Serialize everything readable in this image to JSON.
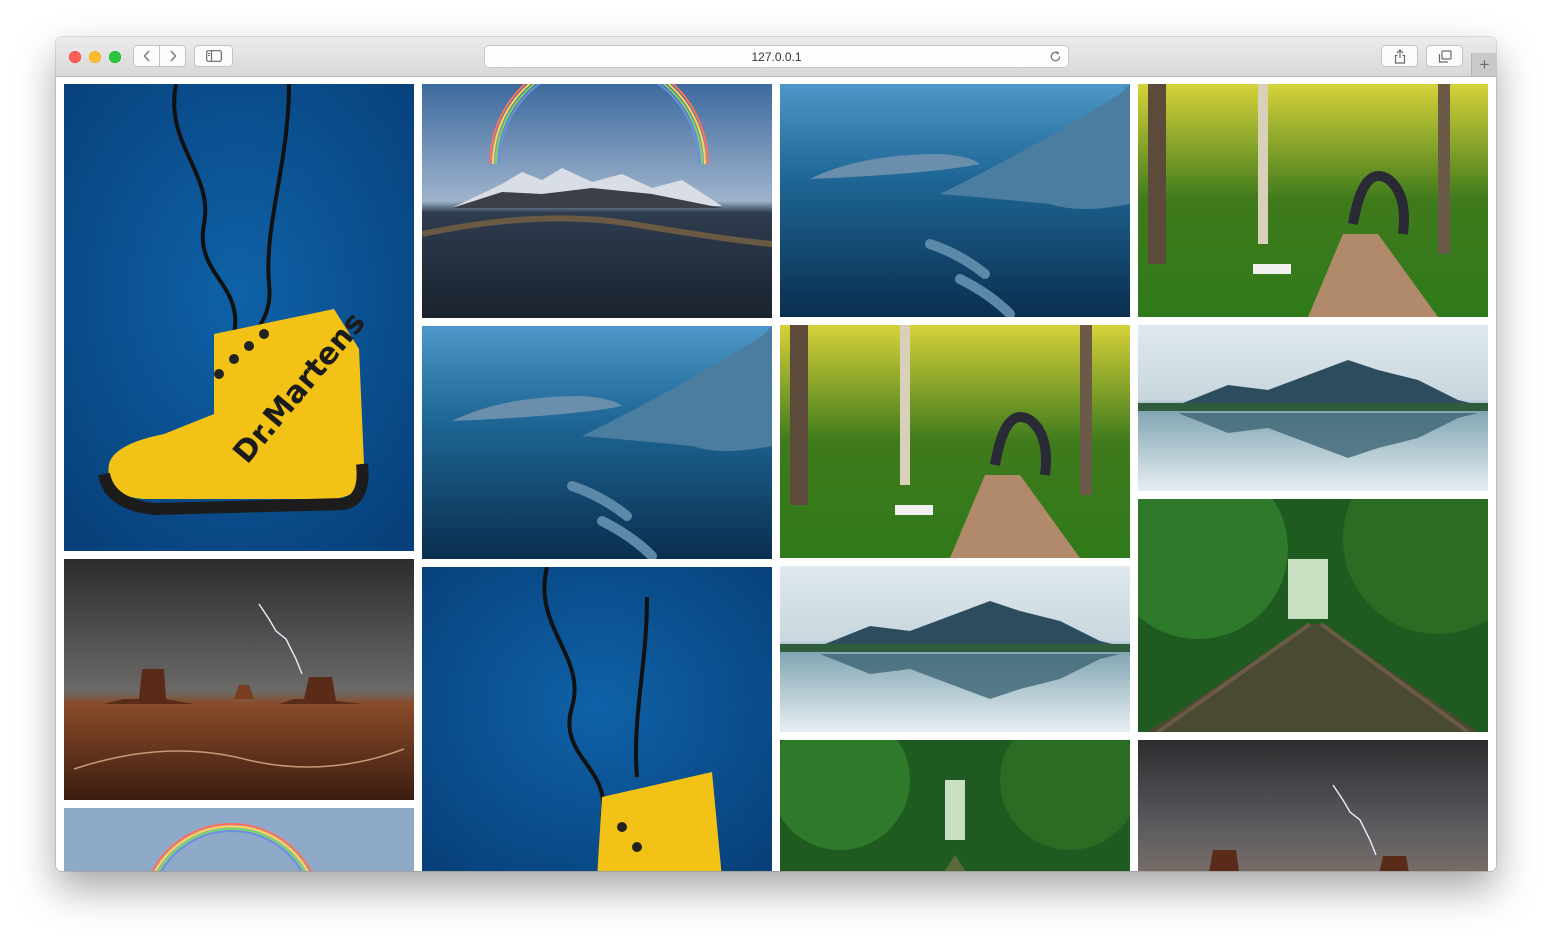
{
  "browser": {
    "url": "127.0.0.1",
    "buttons": {
      "back": "back",
      "forward": "forward",
      "sidebar": "sidebar",
      "reload": "reload",
      "share": "share",
      "tabs": "tab overview",
      "new_tab": "+"
    }
  },
  "gallery": {
    "items": [
      {
        "subject": "yellow-boot"
      },
      {
        "subject": "mountain-rainbow"
      },
      {
        "subject": "dolphins"
      },
      {
        "subject": "forest-path"
      },
      {
        "subject": "dolphins"
      },
      {
        "subject": "forest-path"
      },
      {
        "subject": "lake-reflection"
      },
      {
        "subject": "desert-lightning"
      },
      {
        "subject": "lake-reflection"
      },
      {
        "subject": "railway-forest"
      },
      {
        "subject": "mountain-rainbow"
      },
      {
        "subject": "yellow-boot"
      },
      {
        "subject": "railway-forest"
      },
      {
        "subject": "desert-lightning"
      }
    ]
  }
}
